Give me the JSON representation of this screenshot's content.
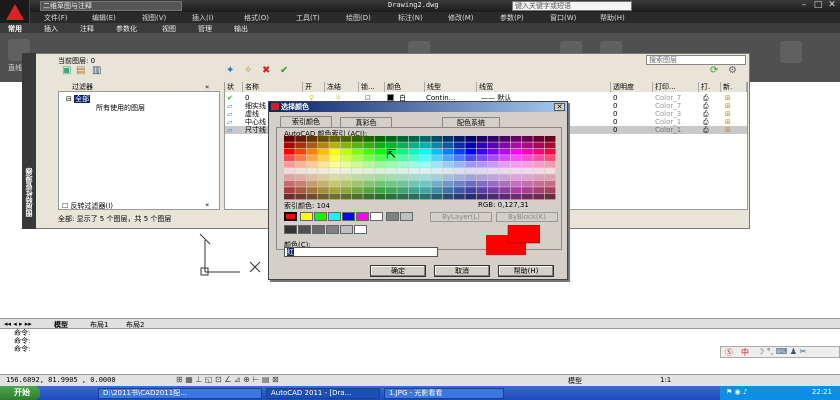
{
  "titlebar": {
    "workspace": "二维草图与注释",
    "doc_title": "Drawing2.dwg",
    "search_placeholder": "键入关键字或短语"
  },
  "menu": [
    "文件(F)",
    "编辑(E)",
    "视图(V)",
    "插入(I)",
    "格式(O)",
    "工具(T)",
    "绘图(D)",
    "标注(N)",
    "修改(M)",
    "参数(P)",
    "窗口(W)",
    "帮助(H)"
  ],
  "ribbon_tabs": [
    "常用",
    "插入",
    "注释",
    "参数化",
    "视图",
    "管理",
    "输出"
  ],
  "ribbon_straight": "直线",
  "layer_manager": {
    "side_title": "图层特性管理器",
    "current_layer": "当前图层: 0",
    "search_placeholder": "搜索图层",
    "filter_header": "过滤器",
    "tree_all": "全部",
    "tree_used": "所有使用的图层",
    "invert_filter": "反转过滤器(I)",
    "status": "全部: 显示了 5 个图层，共 5 个图层",
    "columns": [
      "状",
      "名称",
      "开",
      "冻结",
      "锁...",
      "颜色",
      "线型",
      "线宽",
      "透明度",
      "打印...",
      "打.",
      "新."
    ],
    "rows": [
      {
        "name": "0",
        "color": "白",
        "linetype": "Contin...",
        "lineweight": "—— 默认",
        "transparency": "0",
        "plotstyle": "Color_7"
      },
      {
        "name": "细实线",
        "color": "",
        "linetype": "",
        "lineweight": "",
        "transparency": "0",
        "plotstyle": "Color_7"
      },
      {
        "name": "虚线",
        "color": "",
        "linetype": "",
        "lineweight": "",
        "transparency": "0",
        "plotstyle": "Color_3"
      },
      {
        "name": "中心线",
        "color": "",
        "linetype": "",
        "lineweight": "",
        "transparency": "0",
        "plotstyle": "Color_1"
      },
      {
        "name": "尺寸线",
        "color": "",
        "linetype": "",
        "lineweight": "",
        "transparency": "0",
        "plotstyle": "Color_1"
      }
    ]
  },
  "color_dialog": {
    "title": "选择颜色",
    "tabs": [
      "索引颜色",
      "真彩色",
      "配色系统"
    ],
    "aci_label": "AutoCAD 颜色索引 (ACI):",
    "index_label": "索引颜色: 104",
    "rgb_label": "RGB: 0,127,31",
    "bylayer": "ByLayer(L)",
    "byblock": "ByBlock(K)",
    "color_label": "颜色(C):",
    "color_value": "红",
    "ok": "确定",
    "cancel": "取消",
    "help": "帮助(H)",
    "preview_color": "#ff0000"
  },
  "layout_tabs": [
    "模型",
    "布局1",
    "布局2"
  ],
  "command_lines": [
    "命令:",
    "命令:",
    "命令:"
  ],
  "status": {
    "coords": "156.6892, 81.9905 , 0.0000",
    "model": "模型",
    "scale": "1:1"
  },
  "taskbar": {
    "start": "开始",
    "tasks": [
      "D:\\2011书\\CAD2011配...",
      "AutoCAD 2011 - [Dra...",
      "1.JPG - 光影看看"
    ],
    "clock": "22:21"
  }
}
